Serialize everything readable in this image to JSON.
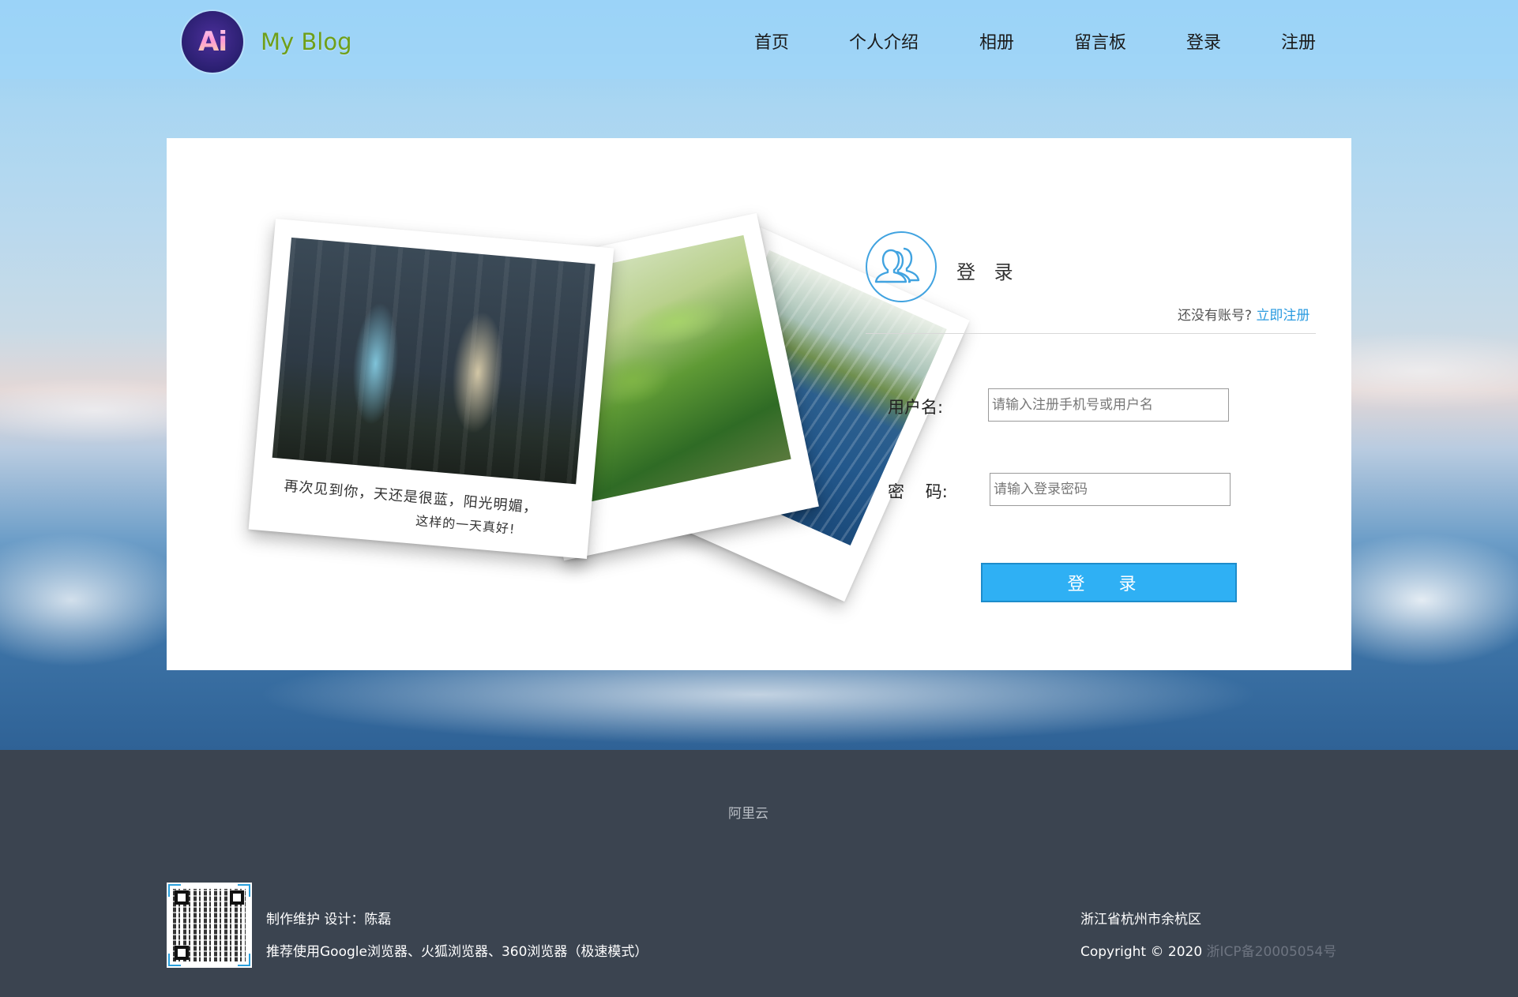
{
  "header": {
    "logo_text": "Ai",
    "site_name": "My Blog",
    "nav": [
      {
        "label": "首页"
      },
      {
        "label": "个人介绍"
      },
      {
        "label": "相册"
      },
      {
        "label": "留言板"
      },
      {
        "label": "登录"
      },
      {
        "label": "注册"
      }
    ]
  },
  "photos": {
    "caption_line1": "再次见到你，天还是很蓝，阳光明媚，",
    "caption_line2": "这样的一天真好!"
  },
  "login": {
    "title": "登 录",
    "no_account_text": "还没有账号?",
    "register_link": "立即注册",
    "username_label": "用户名:",
    "username_placeholder": "请输入注册手机号或用户名",
    "username_value": "",
    "password_label": "密    码:",
    "password_placeholder": "请输入登录密码",
    "password_value": "",
    "submit_label": "登 录"
  },
  "footer": {
    "link": "阿里云",
    "maintainer": "制作维护 设计：陈磊",
    "browser_tip": "推荐使用Google浏览器、火狐浏览器、360浏览器（极速模式）",
    "location": "浙江省杭州市余杭区",
    "copyright": "Copyright © 2020",
    "icp": "浙ICP备20005054号"
  },
  "colors": {
    "accent": "#2fb0f4",
    "link": "#2b9be0",
    "site_name": "#6f9f18",
    "footer_bg": "#3b4450"
  }
}
